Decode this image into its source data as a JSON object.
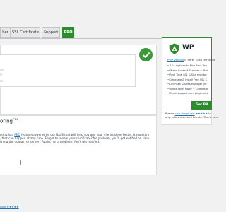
{
  "tabs": [
    {
      "label": "her"
    },
    {
      "label": "SSL Certificate"
    },
    {
      "label": "Support"
    },
    {
      "label": "PRO"
    }
  ],
  "pro_widget": {
    "title": "WP",
    "pro_line_prefix": "",
    "pro_line_link": "PRO version",
    "pro_line_suffix": " is here! Grab the launc",
    "features": [
      "15+ Options to Fine-Tune You",
      "Mixed Content Scanner + Fixe",
      "Real Time SSL & Site monitor",
      "Generate & Install Free SSL C",
      "Licenses & Sites Manager (re",
      "White-label Mode + Complete",
      "Email support from plugin dev"
    ],
    "button_label": "Get PR"
  },
  "monitoring": {
    "title": "oring",
    "title_sup": "PRO",
    "para_line1_prefix": "oring is a ",
    "para_line1_link": "PRO",
    "para_line1_suffix": " feature powered by our SaaS that will help you and your clients sleep better. It monitors",
    "para_line2": ", that can happen at any time. Forgot to renew your certificate? No problem, you'll get notified on time.",
    "para_line3": "ching the domain or server? Again, not a problem. You'll get notified."
  },
  "rate_box": {
    "prefix": "Please ",
    "link": "rate the plugin",
    "stars": "★★★★★",
    "suffix": " to ",
    "line2": "only takes a second to rate. Thank you"
  },
  "footer": {
    "link": "ugin",
    "stars": "★★★★★"
  }
}
